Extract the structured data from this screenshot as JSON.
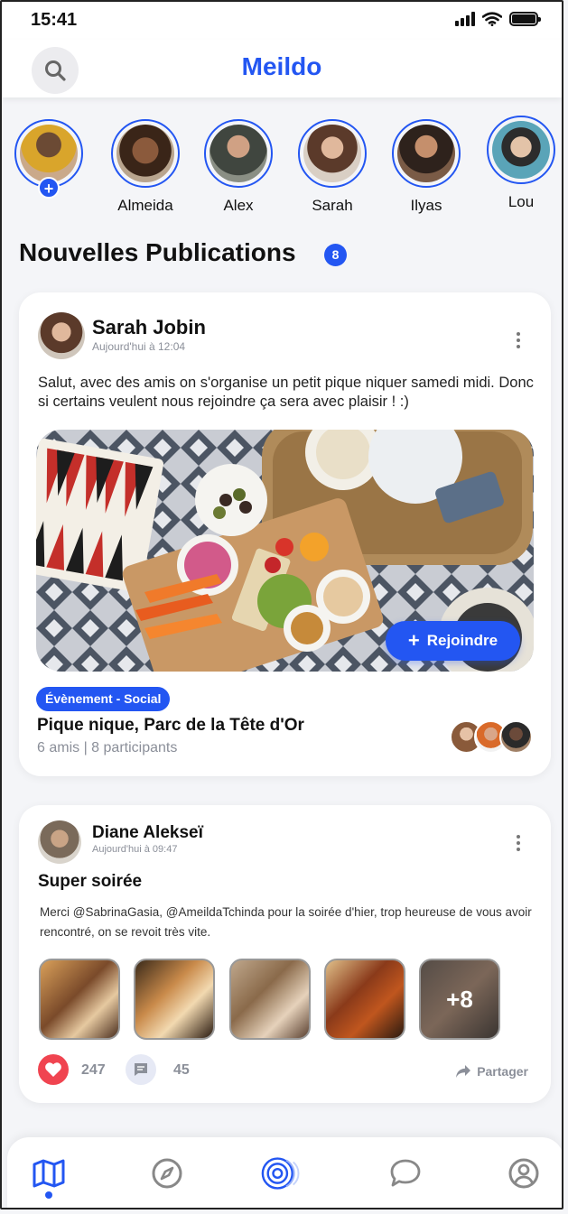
{
  "status_bar": {
    "time": "15:41"
  },
  "header": {
    "title": "Meildo",
    "search_icon": "search-icon"
  },
  "stories": [
    {
      "name": "",
      "has_add": true,
      "add_label": "+"
    },
    {
      "name": "Almeida"
    },
    {
      "name": "Alex"
    },
    {
      "name": "Sarah"
    },
    {
      "name": "Ilyas"
    },
    {
      "name": "Lou"
    }
  ],
  "feed": {
    "title": "Nouvelles Publications",
    "count": "8"
  },
  "post1": {
    "author": "Sarah Jobin",
    "time": "Aujourd'hui à 12:04",
    "text": "Salut, avec des amis on s'organise un petit pique niquer samedi midi. Donc si certains veulent nous rejoindre ça sera avec plaisir !   :)",
    "join_label": "Rejoindre",
    "event_type": "Évènement - Social",
    "event_title": "Pique nique, Parc de la Tête d'Or",
    "event_sub": "6 amis | 8 participants"
  },
  "post2": {
    "author": "Diane Alekseï",
    "time": "Aujourd'hui à 09:47",
    "title": "Super soirée",
    "text": "Merci @SabrinaGasia, @AmeildaTchinda pour la soirée d'hier, trop heureuse de vous avoir rencontré, on se revoit très vite.",
    "extra_photos": "+8",
    "likes": "247",
    "comments": "45",
    "share_label": "Partager"
  },
  "bottom_nav": [
    "map-icon",
    "compass-icon",
    "radar-icon",
    "chat-icon",
    "profile-icon"
  ],
  "colors": {
    "accent": "#2356f2",
    "like": "#f04450",
    "muted": "#8b8f99"
  }
}
